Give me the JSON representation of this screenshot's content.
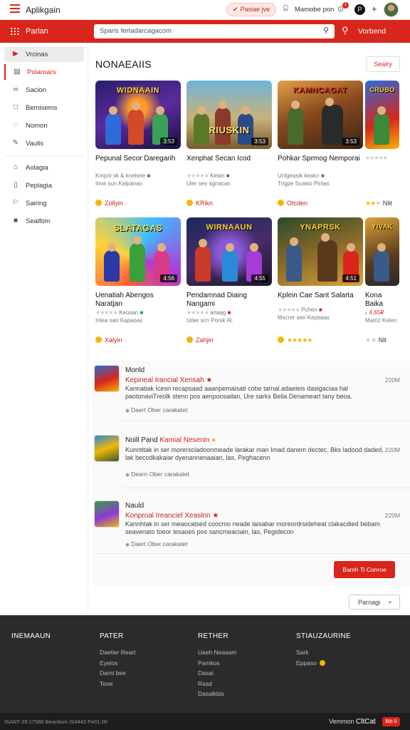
{
  "topbar": {
    "app_title": "Aplikgain",
    "pill_label": "Pasiae jve",
    "link_label": "Mamobe pon",
    "notif_count": "1"
  },
  "nav": {
    "title": "Parlan",
    "search_value": "Sparis fertadarcagacom",
    "right_label": "Vorbend"
  },
  "sidebar": {
    "items": [
      {
        "label": "Vrcinas",
        "icon": "play-icon"
      },
      {
        "label": "Polaroars",
        "icon": "stack-icon"
      },
      {
        "label": "Sacion",
        "icon": "link-icon"
      },
      {
        "label": "Bemisems",
        "icon": "square-icon"
      },
      {
        "label": "Nomon",
        "icon": "chat-icon"
      },
      {
        "label": "Vaulis",
        "icon": "pen-icon"
      },
      {
        "label": "Aolagia",
        "icon": "home-icon"
      },
      {
        "label": "Peplagia",
        "icon": "doc-icon"
      },
      {
        "label": "Sairing",
        "icon": "pin-icon"
      },
      {
        "label": "Sealfom",
        "icon": "bag-icon"
      }
    ]
  },
  "section": {
    "title": "NONAEAIIS",
    "sort_label": "Seairy"
  },
  "cards": [
    {
      "art_title": "WIDNAAIN",
      "duration": "3:53",
      "title": "Pepunal Secor Daregarih",
      "meta1": "Kmpni sk & knelsne",
      "meta2": "Inva sun Kalpanas",
      "price": "Zollyin"
    },
    {
      "art_title": "RIUSKIN",
      "duration": "3:53",
      "title": "Xenphat Secan Icod",
      "meta1": "Kelan",
      "meta2": "Uier sev sgnacan",
      "price": "KRikn"
    },
    {
      "art_title": "KAMNCAGAT",
      "duration": "3:53",
      "title": "Pohkar Sprmog Nemporai",
      "meta1": "Unlgeasik keaicr",
      "meta2": "Trigpe Scaiso Pinlas",
      "price": "Otcden"
    },
    {
      "art_title": "CRUBO",
      "duration": "",
      "title": "",
      "meta1": "",
      "meta2": "",
      "price": "Nlit"
    },
    {
      "art_title": "SLATAGAS",
      "duration": "4:56",
      "title": "Uenatiah Abengos Naratjan",
      "meta1": "Keosan",
      "meta2": "Inlea san Kapaoas",
      "price": "Xalyin"
    },
    {
      "art_title": "WIRNAAUN",
      "duration": "4:55",
      "title": "Pendamnad Diaing Nangami",
      "meta1": "anaag",
      "meta2": "Uder scn Porsk Al.",
      "price": "Zahjin"
    },
    {
      "art_title": "YNAPRSK",
      "duration": "4:51",
      "title": "Kplein Cae Sant Salarta",
      "meta1": "Pchen",
      "meta2": "Mscrer sen Kepsaas",
      "price": ""
    },
    {
      "art_title": "YIVAK",
      "duration": "",
      "title": "Kona Baika",
      "meta1": "",
      "meta2": "Matriz Kelen",
      "price": "Nlt"
    }
  ],
  "comments": [
    {
      "name": "Monld",
      "name_red": "",
      "headline": "Kepineal Irancial Xensah",
      "time": "220M",
      "body": "Kannatiak Icesn recapsaad aaanpemaisati cobe tarnal.adaeleis dasigaciaa hal paotonaviTreolk stenn pos aenpoosailan, Ure sarks Beila Denameart tany beoa.",
      "reply": "Daert Ober carakatet"
    },
    {
      "name": "Noill Pand",
      "name_red": "Kamial Nesenin",
      "headline": "",
      "time": "220M",
      "body": "Kunntitak in ser morersciadoonmeade larakar man Imad danem dectec, Bks ladood daded, lak becodkakaiar dyenannenaaian, las, Peghacenn",
      "reply": "Dearn Ober carakatet"
    },
    {
      "name": "Nauld",
      "name_red": "",
      "headline": "Konproal Ireanciel Xeaslnn",
      "time": "220M",
      "body": "Kannhtak in ser meaocatsed coocmo neade laisabar moreordrsideheat clakacdied bebam seavenato toeor lesaoes pos sancmeaciain, las, Pegidecon",
      "reply": "Daert Ober carakatet"
    }
  ],
  "load_more": "Bamh Ti Conroe",
  "pager": "Parnagi",
  "footer": {
    "columns": [
      {
        "heading": "INEMAAUN",
        "links": []
      },
      {
        "heading": "PATER",
        "links": [
          "Daetler Reart",
          "Eyelos",
          "Damt bee",
          "Tone"
        ]
      },
      {
        "heading": "RETHER",
        "links": [
          "Uaeh Neasam",
          "Pamkos",
          "Dasai",
          "Rasd",
          "Dasalkbis"
        ]
      },
      {
        "heading": "STIAUZAURINE",
        "links": [
          "Sark",
          "Eppaso"
        ]
      }
    ],
    "copyright": "ISANT-25:17588 Beantiom IS4443 Pe01:00",
    "version_label": "Vemmon",
    "version_value": "CltCat",
    "tag": "Bib 0"
  }
}
